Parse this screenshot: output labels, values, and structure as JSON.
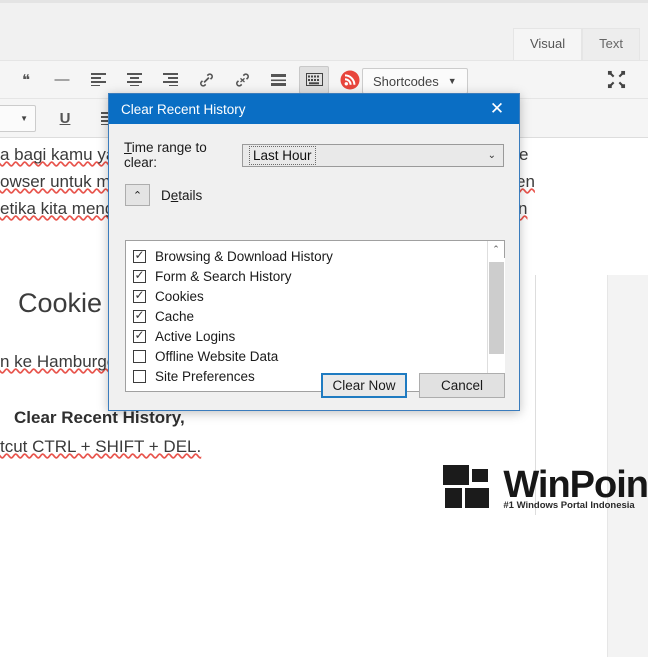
{
  "editor": {
    "tabs": [
      {
        "label": "Visual",
        "active": true
      },
      {
        "label": "Text",
        "active": false
      }
    ],
    "toolbar_row1": [
      {
        "name": "blockquote",
        "glyph": "❝"
      },
      {
        "name": "horizontal-rule",
        "glyph": "—"
      },
      {
        "name": "align-left",
        "glyph": "≡"
      },
      {
        "name": "align-center",
        "glyph": "≡"
      },
      {
        "name": "align-right",
        "glyph": "≡"
      },
      {
        "name": "insert-link",
        "glyph": "🔗"
      },
      {
        "name": "remove-link",
        "glyph": "⛓"
      },
      {
        "name": "read-more",
        "glyph": "▤"
      },
      {
        "name": "keyboard-shortcuts",
        "glyph": "⌨"
      },
      {
        "name": "rss-feed",
        "glyph": "◉"
      }
    ],
    "toolbar_row2": [
      {
        "name": "format-select",
        "glyph": "n"
      },
      {
        "name": "underline",
        "glyph": "U"
      },
      {
        "name": "justify",
        "glyph": "≡"
      }
    ],
    "shortcodes_label": "Shortcodes",
    "fullscreen_icon": "⤡",
    "content": {
      "line1": "a bagi kamu ya",
      "line1_right": "e",
      "line2": "owser untuk me",
      "line2_right": "en",
      "line3": "etika kita meng",
      "line3_right": "n",
      "heading": "Cookie d",
      "line4": "n ke Hamburge",
      "bold_line": "Clear Recent History,",
      "last_line": "tcut CTRL + SHIFT + DEL."
    }
  },
  "dialog": {
    "title": "Clear Recent History",
    "close_icon": "✕",
    "time_range_label": "Time range to clear:",
    "time_range_label_accel": "T",
    "time_range_value": "Last Hour",
    "dropdown_icon": "⌄",
    "details_label": "Details",
    "details_icon": "⌃",
    "items": [
      {
        "label": "Browsing & Download History",
        "checked": true
      },
      {
        "label": "Form & Search History",
        "checked": true
      },
      {
        "label": "Cookies",
        "checked": true
      },
      {
        "label": "Cache",
        "checked": true
      },
      {
        "label": "Active Logins",
        "checked": true
      },
      {
        "label": "Offline Website Data",
        "checked": false
      },
      {
        "label": "Site Preferences",
        "checked": false
      }
    ],
    "scroll_up_icon": "⌃",
    "scroll_down_icon": "⌄",
    "clear_now_label": "Clear Now",
    "cancel_label": "Cancel",
    "title_bar_color": "#0a6ec4",
    "focus_border_color": "#1f7bc1"
  },
  "watermark": {
    "brand": "WinPoin",
    "tagline": "#1 Windows Portal Indonesia"
  }
}
